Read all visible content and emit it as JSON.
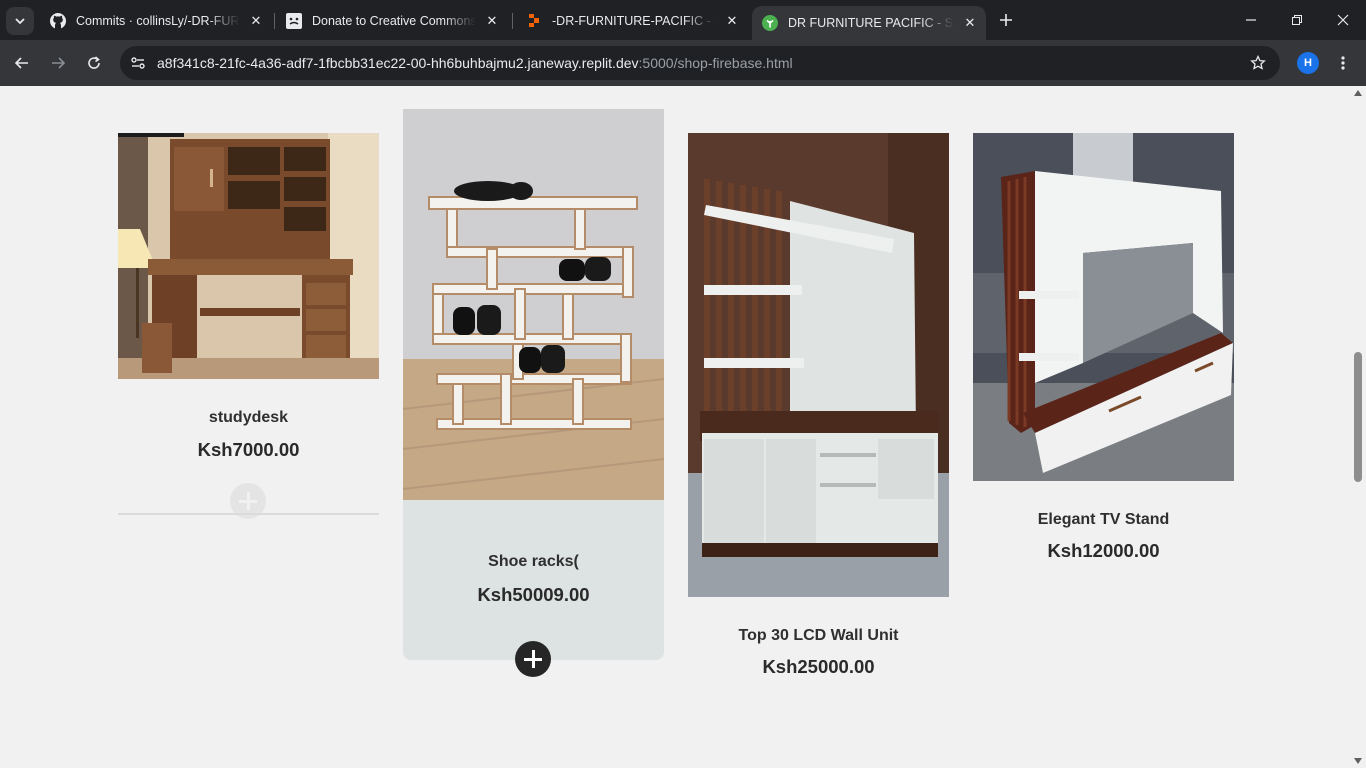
{
  "browser": {
    "tabs": [
      {
        "title": "Commits · collinsLy/-DR-FURNITURE-PACIFIC",
        "icon": "github-icon",
        "active": false
      },
      {
        "title": "Donate to Creative Commons Donate",
        "icon": "creative-commons-icon",
        "active": false
      },
      {
        "title": "-DR-FURNITURE-PACIFIC - Replit",
        "icon": "replit-icon",
        "active": false
      },
      {
        "title": "DR FURNITURE PACIFIC - Shop",
        "icon": "leaf-icon",
        "active": true
      }
    ],
    "url_host": "a8f341c8-21fc-4a36-adf7-1fbcbb31ec22-00-hh6buhbajmu2.janeway.replit.dev",
    "url_path": ":5000/shop-firebase.html",
    "profile_initial": "H",
    "accent": "#1a73e8"
  },
  "products": [
    {
      "name": "studydesk",
      "price": "Ksh7000.00",
      "image": "study-desk-image"
    },
    {
      "name": "Shoe racks(",
      "price": "Ksh50009.00",
      "image": "shoe-rack-image"
    },
    {
      "name": "Top 30 LCD Wall Unit",
      "price": "Ksh25000.00",
      "image": "lcd-wall-unit-image"
    },
    {
      "name": "Elegant TV Stand",
      "price": "Ksh12000.00",
      "image": "tv-stand-image"
    }
  ]
}
